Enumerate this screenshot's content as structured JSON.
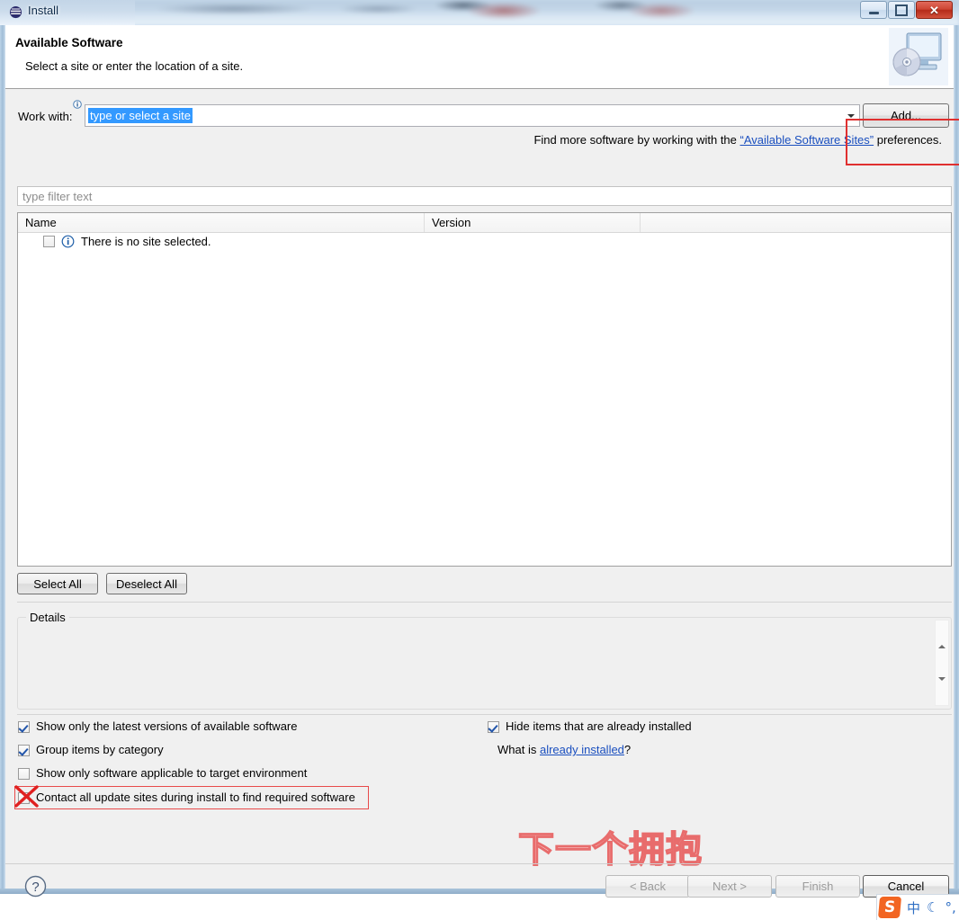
{
  "window": {
    "title": "Install",
    "icon": "eclipse-icon",
    "caption_buttons": {
      "minimize": "minimize-button",
      "maximize": "maximize-button",
      "close_label": "✕"
    }
  },
  "header": {
    "title": "Available Software",
    "subtitle": "Select a site or enter the location of a site.",
    "icon": "monitor-disc-icon"
  },
  "work_with": {
    "label": "Work with:",
    "info_icon": "info-icon",
    "combo_value": "type or select a site",
    "combo_placeholder": "type or select a site",
    "add_button": "Add...",
    "find_more_prefix": "Find more software by working with the ",
    "find_more_link": "“Available Software Sites”",
    "find_more_suffix": " preferences."
  },
  "filter": {
    "placeholder": "type filter text",
    "value": ""
  },
  "table": {
    "columns": [
      "Name",
      "Version",
      ""
    ],
    "rows": [
      {
        "name": "There is no site selected.",
        "version": "",
        "checked": false,
        "icon": "info-icon"
      }
    ]
  },
  "table_buttons": {
    "select_all": "Select All",
    "deselect_all": "Deselect All"
  },
  "details": {
    "label": "Details",
    "content": ""
  },
  "options": {
    "left": [
      {
        "label": "Show only the latest versions of available software",
        "checked": true
      },
      {
        "label": "Group items by category",
        "checked": true
      },
      {
        "label": "Show only software applicable to target environment",
        "checked": false
      },
      {
        "label": "Contact all update sites during install to find required software",
        "checked": false
      }
    ],
    "right": [
      {
        "label": "Hide items that are already installed",
        "checked": true
      }
    ],
    "what_is_prefix": "What is ",
    "what_is_link": "already installed",
    "what_is_suffix": "?"
  },
  "footer": {
    "help_icon": "help-icon",
    "back": "< Back",
    "next": "Next >",
    "finish": "Finish",
    "cancel": "Cancel"
  },
  "annotations": {
    "watermark_text": "下一个拥抱",
    "watermark_color": "#e86c6c",
    "box_color": "#e03030",
    "add_box": "red-rect-around-add-button",
    "contact_box": "red-rect-around-contact-option",
    "contact_x": "red-x-over-checkbox"
  },
  "ime": {
    "logo": "S",
    "mode": "中",
    "moon": "☾",
    "punct": "°,"
  }
}
